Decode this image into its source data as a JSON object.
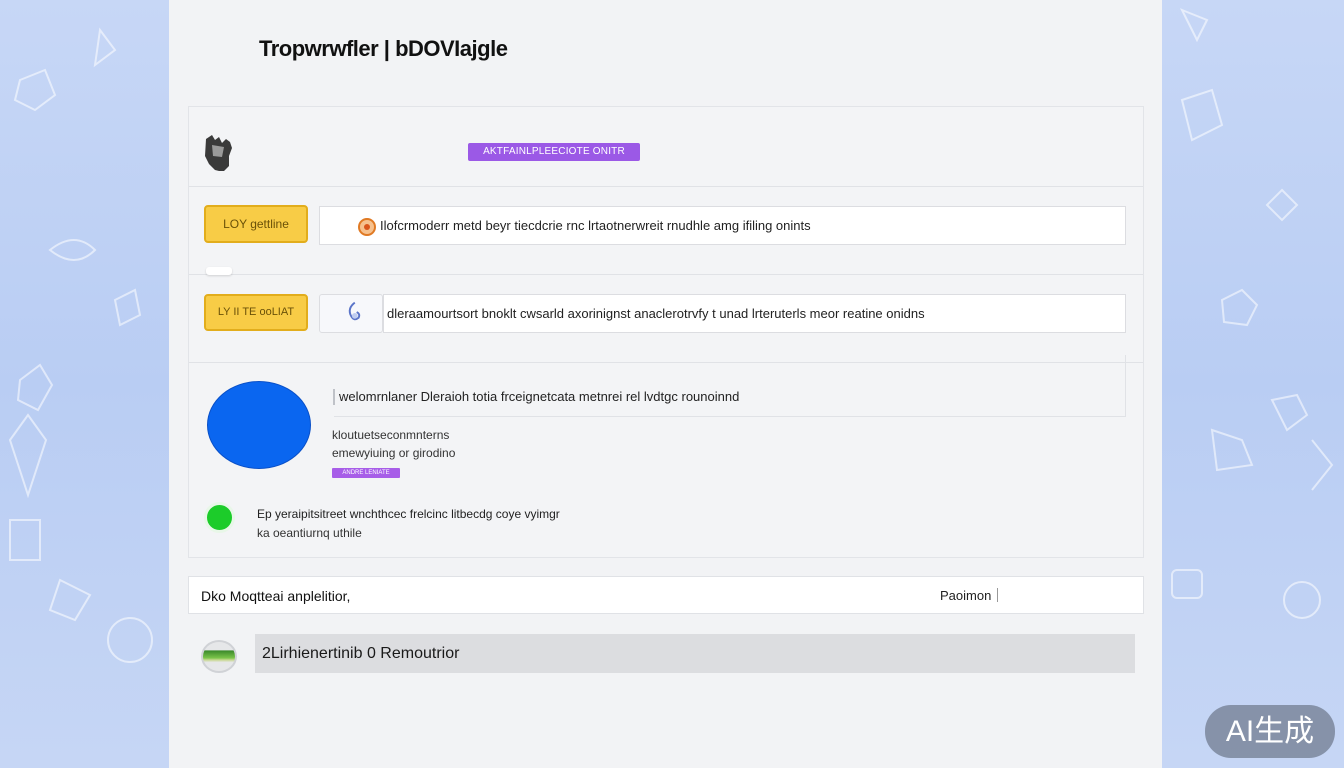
{
  "header": {
    "title": "Tropwrwfler | bDOVIajgle"
  },
  "panel": {
    "head_badge": "AKTFAINLPLEECIOTE ONITR",
    "row1": {
      "button_label": "LOY gettline",
      "field_text": "Ilofcrmoderr metd beyr tiecdcrie rnc lrtaotnerwreit rnudhle amg ifiling onints"
    },
    "row2": {
      "button_label": "LY II TE ooLIAT",
      "field_text": "dleraamourtsort bnoklt cwsarld axorinignst anaclerotrvfy t unad lrteruterls meor reatine onidns"
    },
    "feature": {
      "main_text": "welomrnlaner Dleraioh totia frceignetcata metnrei rel lvdtgc rounoinnd",
      "sub_line1": "kloutuetseconmnterns",
      "sub_line2": "emewyiuing or girodino",
      "mini_badge": "ANDRE LENIATE"
    },
    "green_item": {
      "line1": "Ep yeraipitsitreet wnchthcec frelcinc litbecdg coye vyimgr",
      "line2": "ka oeantiurnq uthile"
    }
  },
  "bar": {
    "left_text": "Dko Moqtteai anplelitior,",
    "right_text": "Paoimon"
  },
  "bottom": {
    "text": "2Lirhienertinib 0 Remoutrior"
  },
  "watermark": {
    "text": "AI生成"
  },
  "colors": {
    "page_bg": "#f2f3f5",
    "side_bg": "#c7d7f6",
    "accent_purple": "#9b59e6",
    "accent_yellow": "#f8cc46",
    "circle_blue": "#0a66f0",
    "dot_green": "#1ccc2a"
  },
  "icons": {
    "header_thumb": "sketch-thumbnail-icon",
    "row1_icon": "orange-badge-icon",
    "row2_icon": "blue-swirl-icon",
    "feature_shape": "blue-circle-icon",
    "green_item": "green-dot-icon",
    "bottom_avatar": "landscape-avatar-icon"
  }
}
